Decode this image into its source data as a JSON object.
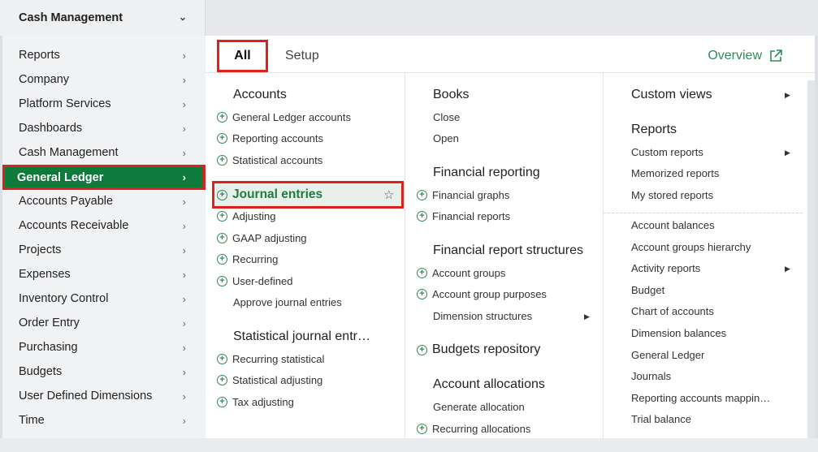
{
  "module": {
    "label": "Cash Management"
  },
  "nav": [
    "Reports",
    "Company",
    "Platform Services",
    "Dashboards",
    "Cash Management",
    "General Ledger",
    "Accounts Payable",
    "Accounts Receivable",
    "Projects",
    "Expenses",
    "Inventory Control",
    "Order Entry",
    "Purchasing",
    "Budgets",
    "User Defined Dimensions",
    "Time"
  ],
  "tabs": {
    "all": "All",
    "setup": "Setup",
    "overview": "Overview"
  },
  "col1": {
    "accounts": {
      "title": "Accounts",
      "items": [
        "General Ledger accounts",
        "Reporting accounts",
        "Statistical accounts"
      ]
    },
    "journal": {
      "title": "Journal entries",
      "items": [
        "Adjusting",
        "GAAP adjusting",
        "Recurring",
        "User-defined",
        "Approve journal entries"
      ]
    },
    "statistical": {
      "title": "Statistical journal entr…",
      "items": [
        "Recurring statistical",
        "Statistical adjusting",
        "Tax adjusting"
      ]
    }
  },
  "col2": {
    "books": {
      "title": "Books",
      "items": [
        "Close",
        "Open"
      ]
    },
    "financial_reporting": {
      "title": "Financial reporting",
      "items": [
        "Financial graphs",
        "Financial reports"
      ]
    },
    "structures": {
      "title": "Financial report structures",
      "items": [
        "Account groups",
        "Account group purposes",
        "Dimension structures"
      ]
    },
    "budgets": {
      "title": "Budgets repository"
    },
    "allocations": {
      "title": "Account allocations",
      "items": [
        "Generate allocation",
        "Recurring allocations"
      ]
    }
  },
  "col3": {
    "custom_views": {
      "title": "Custom views"
    },
    "reports": {
      "title": "Reports",
      "items": [
        "Custom reports",
        "Memorized reports",
        "My stored reports"
      ]
    },
    "list": [
      "Account balances",
      "Account groups hierarchy",
      "Activity reports",
      "Budget",
      "Chart of accounts",
      "Dimension balances",
      "General Ledger",
      "Journals",
      "Reporting accounts mappin…",
      "Trial balance"
    ]
  },
  "colors": {
    "accent_green": "#0e7a3c",
    "link_green": "#2e8a57",
    "highlight_red": "#e0201b"
  }
}
